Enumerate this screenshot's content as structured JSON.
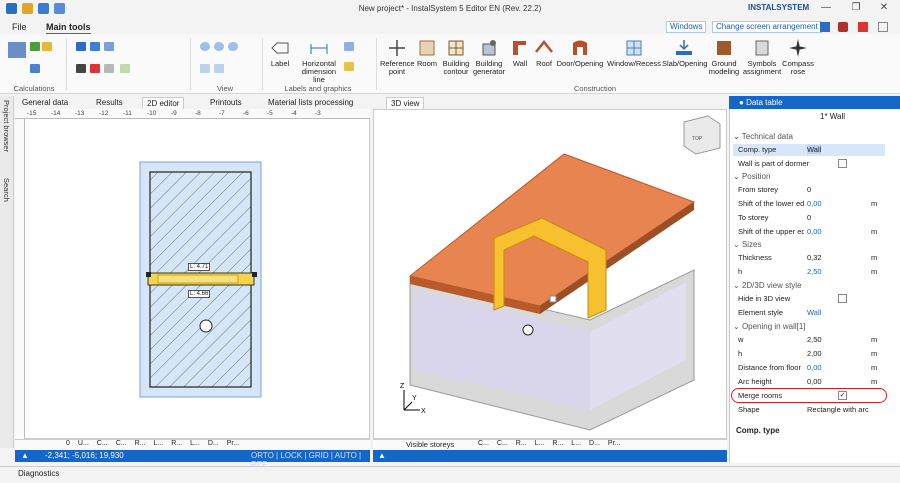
{
  "window": {
    "title": "New project* - InstalSystem 5 Editor EN (Rev. 22.2)",
    "brand": "INSTALSYSTEM"
  },
  "menu": {
    "file": "File",
    "main_tools": "Main tools",
    "windows": "Windows",
    "change_screen": "Change screen arrangement"
  },
  "ribbon": {
    "groups": {
      "calculations": "Calculations",
      "view": "View",
      "labels_graphics": "Labels and graphics",
      "construction": "Construction"
    },
    "buttons": {
      "label": "Label",
      "horizontal_dimension": "Horizontal dimension line",
      "reference_point": "Reference point",
      "room": "Room",
      "building_contour": "Building contour",
      "building_generator": "Building generator",
      "wall": "Wall",
      "roof": "Roof",
      "door_opening": "Door/Opening",
      "window_recess": "Window/Recess",
      "slab_opening": "Slab/Opening",
      "ground_modeling": "Ground modeling",
      "symbols_assignment": "Symbols assignment",
      "compass_rose": "Compass rose"
    }
  },
  "sidebar": {
    "project_browser": "Project browser",
    "search": "Search"
  },
  "tabs": {
    "general_data": "General data",
    "results": "Results",
    "editor_2d": "2D editor",
    "printouts": "Printouts",
    "material_lists": "Material lists processing",
    "view_3d": "3D view"
  },
  "editor2d": {
    "ruler_ticks": [
      "-15",
      "-14",
      "-13",
      "-12",
      "-11",
      "-10",
      "-9",
      "-8",
      "-7",
      "-6",
      "-5",
      "-4",
      "-3"
    ],
    "dim_top": "4.71",
    "dim_bottom": "4.66",
    "status_items": [
      "0",
      "U...",
      "C...",
      "C...",
      "R...",
      "L...",
      "R...",
      "L...",
      "D...",
      "Pr..."
    ],
    "coords": "-2,341; -5,016; 19,930",
    "modes": "ORTO | LOCK | GRID | AUTO | REF"
  },
  "view3d": {
    "cube_label": "TOP",
    "visible_storeys": "Visible storeys",
    "status_items": [
      "C...",
      "C...",
      "R...",
      "L...",
      "R...",
      "L...",
      "D...",
      "Pr..."
    ],
    "axes": [
      "Z",
      "Y",
      "X"
    ]
  },
  "data_table": {
    "title": "Data table",
    "element": "1* Wall",
    "sections": {
      "technical": "Technical data",
      "position": "Position",
      "sizes": "Sizes",
      "view": "2D/3D view style",
      "opening": "Opening in wall[1]"
    },
    "rows": {
      "comp_type": {
        "label": "Comp. type",
        "value": "Wall"
      },
      "part_of_dormer": {
        "label": "Wall is part of dormer"
      },
      "from_storey": {
        "label": "From storey",
        "value": "0"
      },
      "shift_lower": {
        "label": "Shift of the lower edge",
        "value": "0,00",
        "unit": "m"
      },
      "to_storey": {
        "label": "To storey",
        "value": "0"
      },
      "shift_upper": {
        "label": "Shift of the upper edge",
        "value": "0,00",
        "unit": "m"
      },
      "thickness": {
        "label": "Thickness",
        "value": "0,32",
        "unit": "m"
      },
      "height": {
        "label": "h",
        "value": "2,50",
        "unit": "m"
      },
      "hide_3d": {
        "label": "Hide in 3D view"
      },
      "element_style": {
        "label": "Element style",
        "value": "Wall"
      },
      "w": {
        "label": "w",
        "value": "2,50",
        "unit": "m"
      },
      "h2": {
        "label": "h",
        "value": "2,00",
        "unit": "m"
      },
      "distance_floor": {
        "label": "Distance from floor",
        "value": "0,00",
        "unit": "m"
      },
      "arc_height": {
        "label": "Arc height",
        "value": "0,00",
        "unit": "m"
      },
      "merge_rooms": {
        "label": "Merge rooms"
      },
      "shape": {
        "label": "Shape",
        "value": "Rectangle with arc"
      }
    },
    "footer": "Comp. type"
  },
  "diagnostics": "Diagnostics"
}
